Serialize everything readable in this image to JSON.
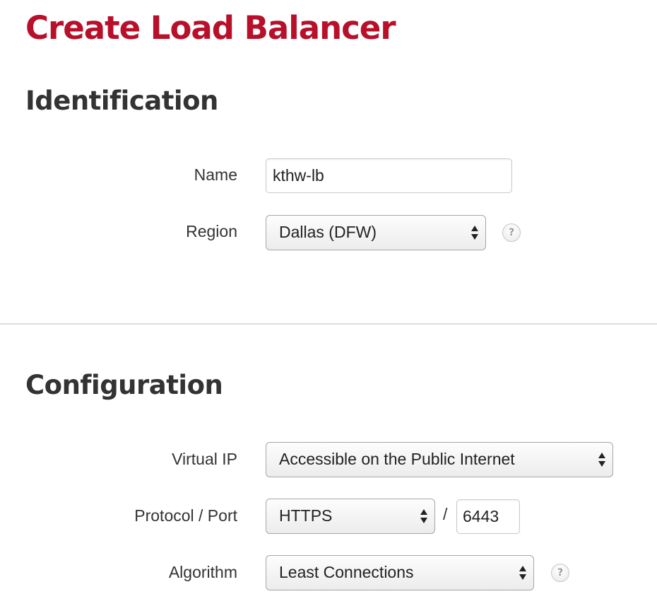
{
  "page": {
    "title": "Create Load Balancer"
  },
  "identification": {
    "heading": "Identification",
    "name": {
      "label": "Name",
      "value": "kthw-lb"
    },
    "region": {
      "label": "Region",
      "value": "Dallas (DFW)",
      "help": "?"
    }
  },
  "configuration": {
    "heading": "Configuration",
    "virtual_ip": {
      "label": "Virtual IP",
      "value": "Accessible on the Public Internet"
    },
    "protocol_port": {
      "label": "Protocol / Port",
      "protocol": "HTTPS",
      "separator": "/",
      "port": "6443"
    },
    "algorithm": {
      "label": "Algorithm",
      "value": "Least Connections",
      "help": "?"
    }
  },
  "theme": {
    "title_color": "#b8102a",
    "text_color": "#333333",
    "divider_color": "#dddddd"
  },
  "icons": {
    "select_arrows": "up-down-arrows-icon",
    "help": "question-mark-icon"
  }
}
